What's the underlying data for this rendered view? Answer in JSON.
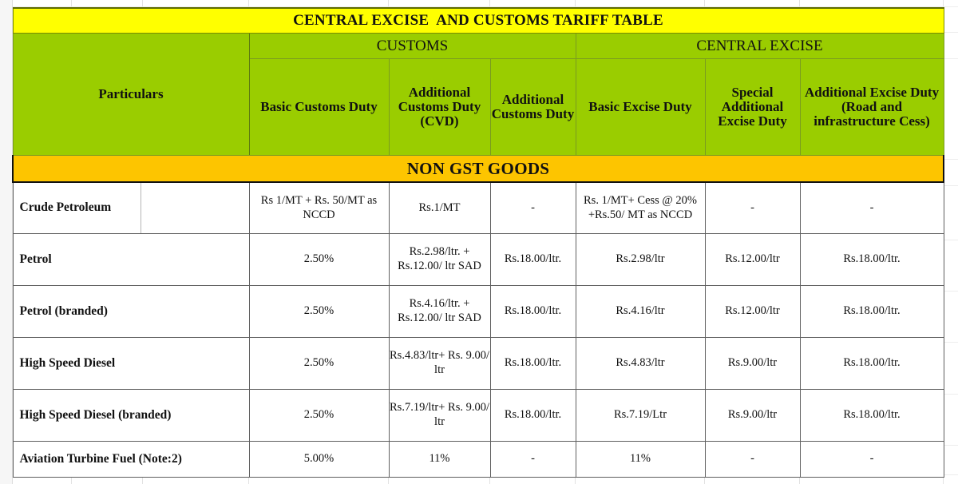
{
  "title_band": {
    "text": "CENTRAL EXCISE  AND CUSTOMS TARIFF TABLE"
  },
  "group_headers": {
    "particulars": "Particulars",
    "customs": "CUSTOMS",
    "central_excise": "CENTRAL EXCISE"
  },
  "column_headers": [
    "Basic Customs Duty",
    "Additional Customs Duty (CVD)",
    "Additional Customs Duty",
    "Basic Excise Duty",
    "Special Additional Excise Duty",
    "Additional Excise Duty (Road and infrastructure Cess)"
  ],
  "section_band": {
    "text": "NON GST GOODS"
  },
  "rows": [
    {
      "particulars": "Crude Petroleum",
      "split_particulars": true,
      "cells": [
        "Rs 1/MT + Rs. 50/MT as NCCD",
        "Rs.1/MT",
        "-",
        "Rs. 1/MT+ Cess @ 20% +Rs.50/ MT as NCCD",
        "-",
        "-"
      ]
    },
    {
      "particulars": "Petrol",
      "split_particulars": false,
      "cells": [
        "2.50%",
        "Rs.2.98/ltr. + Rs.12.00/ ltr SAD",
        "Rs.18.00/ltr.",
        "Rs.2.98/ltr",
        "Rs.12.00/ltr",
        "Rs.18.00/ltr."
      ]
    },
    {
      "particulars": "Petrol (branded)",
      "split_particulars": false,
      "cells": [
        "2.50%",
        "Rs.4.16/ltr. + Rs.12.00/ ltr SAD",
        "Rs.18.00/ltr.",
        "Rs.4.16/ltr",
        "Rs.12.00/ltr",
        "Rs.18.00/ltr."
      ]
    },
    {
      "particulars": "High Speed Diesel",
      "split_particulars": false,
      "cells": [
        "2.50%",
        "Rs.4.83/ltr+ Rs. 9.00/ ltr",
        "Rs.18.00/ltr.",
        "Rs.4.83/ltr",
        "Rs.9.00/ltr",
        "Rs.18.00/ltr."
      ]
    },
    {
      "particulars": "High Speed Diesel (branded)",
      "split_particulars": false,
      "cells": [
        "2.50%",
        "Rs.7.19/ltr+ Rs. 9.00/ ltr",
        "Rs.18.00/ltr.",
        "Rs.7.19/Ltr",
        "Rs.9.00/ltr",
        "Rs.18.00/ltr."
      ]
    },
    {
      "particulars": "Aviation Turbine Fuel (Note:2)",
      "split_particulars": false,
      "cells": [
        "5.00%",
        "11%",
        "-",
        "11%",
        "-",
        "-"
      ]
    }
  ],
  "colors": {
    "title_band": "#FFFF00",
    "header_green": "#9ACD00",
    "section_band": "#FDC500",
    "text": "#111111",
    "grid": "#5F5F5F"
  }
}
